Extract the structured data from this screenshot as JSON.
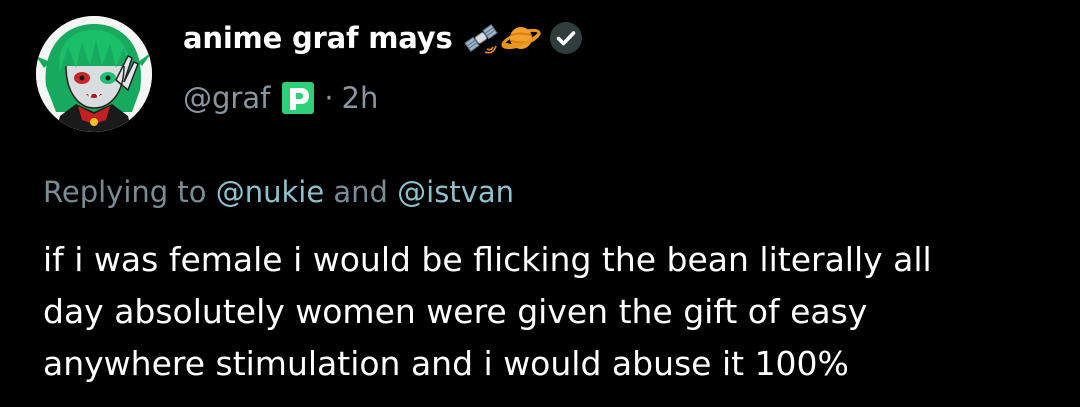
{
  "author": {
    "display_name": "anime graf mays",
    "handle": "@graf",
    "time": "2h",
    "separator": "·",
    "badges": [
      "satellite-emoji",
      "ringed-planet-emoji",
      "verified-check-icon"
    ]
  },
  "reply": {
    "prefix": "Replying to",
    "mention_1": "@nukie",
    "joiner": "and",
    "mention_2": "@istvan"
  },
  "post": {
    "lines": [
      "if i was female i would be flicking the bean literally all",
      "day absolutely women were given the gift of easy",
      "anywhere stimulation and i would abuse it 100%"
    ]
  },
  "colors": {
    "background": "#000000",
    "name": "#ffffff",
    "muted": "#8a95a0",
    "mention": "#8fc1cc",
    "verified": "#2f3b3a",
    "pin_green": "#2fd07a"
  }
}
